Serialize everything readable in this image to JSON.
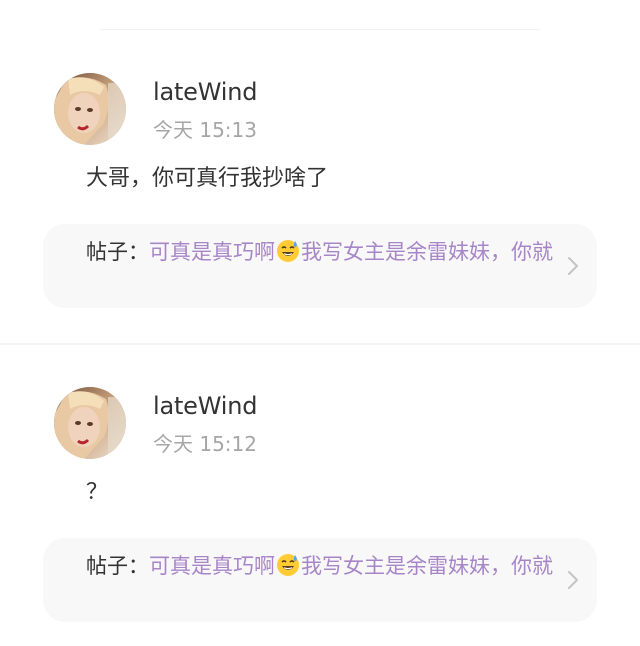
{
  "comments": [
    {
      "username": "lateWind",
      "time": "今天 15:13",
      "text": "大哥，你可真行我抄啥了",
      "post": {
        "prefix": "帖子：",
        "title_part1": "可真是真巧啊",
        "emoji": "sweat-smile-emoji",
        "title_part2": "我写女主是余雷妹妹，你就"
      }
    },
    {
      "username": "lateWind",
      "time": "今天 15:12",
      "text": "？",
      "post": {
        "prefix": "帖子：",
        "title_part1": "可真是真巧啊",
        "emoji": "sweat-smile-emoji",
        "title_part2": "我写女主是余雷妹妹，你就"
      }
    }
  ],
  "colors": {
    "link_purple": "#a786c8",
    "text_dark": "#333333",
    "text_gray": "#a6a6a6",
    "card_bg": "#f8f8f8"
  }
}
